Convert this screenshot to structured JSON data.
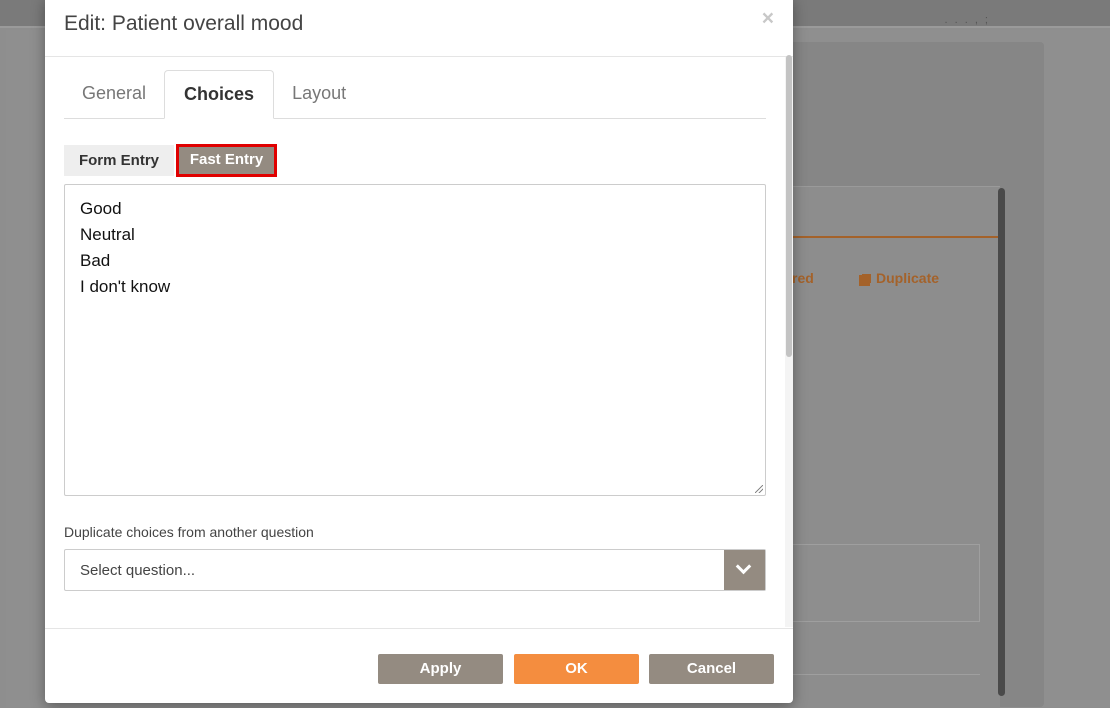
{
  "background": {
    "topbar_text": ". . . , ;",
    "links": {
      "required_label": "red",
      "duplicate_label": "Duplicate"
    }
  },
  "dialog": {
    "title": "Edit: Patient overall mood",
    "close_symbol": "×",
    "tabs": [
      {
        "label": "General",
        "active": false
      },
      {
        "label": "Choices",
        "active": true
      },
      {
        "label": "Layout",
        "active": false
      }
    ],
    "entry_mode": {
      "form_entry_label": "Form Entry",
      "fast_entry_label": "Fast Entry",
      "selected": "Fast Entry"
    },
    "choices": [
      "Good",
      "Neutral",
      "Bad",
      "I don't know"
    ],
    "duplicate_choices_label": "Duplicate choices from another question",
    "select_question_placeholder": "Select question...",
    "buttons": {
      "apply": "Apply",
      "ok": "OK",
      "cancel": "Cancel"
    },
    "colors": {
      "accent_orange": "#f48d3f",
      "neutral_button": "#948b81",
      "highlight_border": "#e00000"
    }
  }
}
